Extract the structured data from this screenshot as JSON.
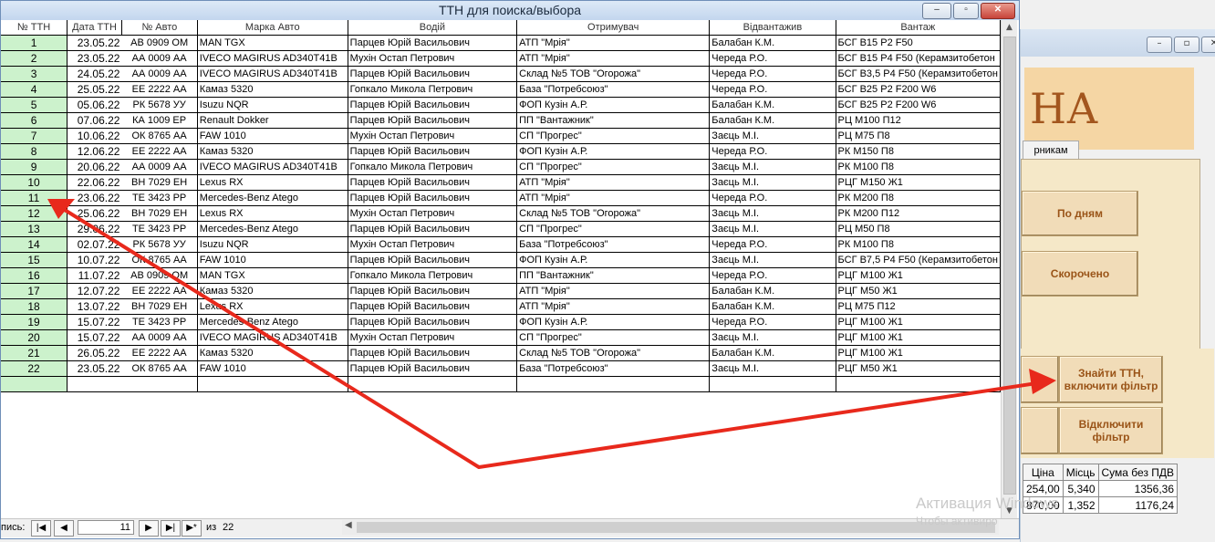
{
  "main_window": {
    "title": "ТТН для поиска/выбора",
    "controls": {
      "minimize": "–",
      "maximize": "▫",
      "close": "✕"
    }
  },
  "grid": {
    "columns": [
      "№ ТТН",
      "Дата ТТН",
      "№ Авто",
      "Марка Авто",
      "Водій",
      "Отримувач",
      "Відвантажив",
      "Вантаж"
    ],
    "rows": [
      [
        "1",
        "23.05.22",
        "АВ 0909 ОМ",
        "MAN TGX",
        "Парцев Юрій Васильович",
        "АТП \"Мрія\"",
        "Балабан К.М.",
        "БСГ В15 Р2 F50"
      ],
      [
        "2",
        "23.05.22",
        "АА 0009 АА",
        "IVECO MAGIRUS AD340T41B",
        "Мухін Остап Петрович",
        "АТП \"Мрія\"",
        "Череда Р.О.",
        "БСГ В15 Р4 F50 (Керамзитобетон"
      ],
      [
        "3",
        "24.05.22",
        "АА 0009 АА",
        "IVECO MAGIRUS AD340T41B",
        "Парцев Юрій Васильович",
        "Склад №5 ТОВ \"Огорожа\"",
        "Череда Р.О.",
        "БСГ В3,5 Р4 F50 (Керамзитобетон"
      ],
      [
        "4",
        "25.05.22",
        "ЕЕ 2222 АА",
        "Камаз 5320",
        "Гопкало Микола Петрович",
        "База \"Потребсоюз\"",
        "Череда Р.О.",
        "БСГ В25 Р2 F200 W6"
      ],
      [
        "5",
        "05.06.22",
        "РК 5678 УУ",
        "Isuzu NQR",
        "Парцев Юрій Васильович",
        "ФОП Кузін А.Р.",
        "Балабан К.М.",
        "БСГ В25 Р2 F200 W6"
      ],
      [
        "6",
        "07.06.22",
        "КА 1009 ЕР",
        "Renault Dokker",
        "Парцев Юрій Васильович",
        "ПП \"Вантажник\"",
        "Балабан К.М.",
        "РЦ М100 П12"
      ],
      [
        "7",
        "10.06.22",
        "ОК 8765 АА",
        "FAW 1010",
        "Мухін Остап Петрович",
        "СП \"Прогрес\"",
        "Заєць М.І.",
        "РЦ М75 П8"
      ],
      [
        "8",
        "12.06.22",
        "ЕЕ 2222 АА",
        "Камаз 5320",
        "Парцев Юрій Васильович",
        "ФОП Кузін А.Р.",
        "Череда Р.О.",
        "РК М150 П8"
      ],
      [
        "9",
        "20.06.22",
        "АА 0009 АА",
        "IVECO MAGIRUS AD340T41B",
        "Гопкало Микола Петрович",
        "СП \"Прогрес\"",
        "Заєць М.І.",
        "РК М100 П8"
      ],
      [
        "10",
        "22.06.22",
        "ВН 7029 ЕН",
        "Lexus RX",
        "Парцев Юрій Васильович",
        "АТП \"Мрія\"",
        "Заєць М.І.",
        "РЦГ М150 Ж1"
      ],
      [
        "11",
        "23.06.22",
        "ТЕ 3423 РР",
        "Mercedes-Benz Atego",
        "Парцев Юрій Васильович",
        "АТП \"Мрія\"",
        "Череда Р.О.",
        "РК М200 П8"
      ],
      [
        "12",
        "25.06.22",
        "ВН 7029 ЕН",
        "Lexus RX",
        "Мухін Остап Петрович",
        "Склад №5 ТОВ \"Огорожа\"",
        "Заєць М.І.",
        "РК М200 П12"
      ],
      [
        "13",
        "29.06.22",
        "ТЕ 3423 РР",
        "Mercedes-Benz Atego",
        "Парцев Юрій Васильович",
        "СП \"Прогрес\"",
        "Заєць М.І.",
        "РЦ М50 П8"
      ],
      [
        "14",
        "02.07.22",
        "РК 5678 УУ",
        "Isuzu NQR",
        "Мухін Остап Петрович",
        "База \"Потребсоюз\"",
        "Череда Р.О.",
        "РК М100 П8"
      ],
      [
        "15",
        "10.07.22",
        "ОК 8765 АА",
        "FAW 1010",
        "Парцев Юрій Васильович",
        "ФОП Кузін А.Р.",
        "Заєць М.І.",
        "БСГ В7,5 Р4 F50 (Керамзитобетон"
      ],
      [
        "16",
        "11.07.22",
        "АВ 0909 ОМ",
        "MAN TGX",
        "Гопкало Микола Петрович",
        "ПП \"Вантажник\"",
        "Череда Р.О.",
        "РЦГ М100 Ж1"
      ],
      [
        "17",
        "12.07.22",
        "ЕЕ 2222 АА",
        "Камаз 5320",
        "Парцев Юрій Васильович",
        "АТП \"Мрія\"",
        "Балабан К.М.",
        "РЦГ М50 Ж1"
      ],
      [
        "18",
        "13.07.22",
        "ВН 7029 ЕН",
        "Lexus RX",
        "Парцев Юрій Васильович",
        "АТП \"Мрія\"",
        "Балабан К.М.",
        "РЦ М75 П12"
      ],
      [
        "19",
        "15.07.22",
        "ТЕ 3423 РР",
        "Mercedes-Benz Atego",
        "Парцев Юрій Васильович",
        "ФОП Кузін А.Р.",
        "Череда Р.О.",
        "РЦГ М100 Ж1"
      ],
      [
        "20",
        "15.07.22",
        "АА 0009 АА",
        "IVECO MAGIRUS AD340T41B",
        "Мухін Остап Петрович",
        "СП \"Прогрес\"",
        "Заєць М.І.",
        "РЦГ М100 Ж1"
      ],
      [
        "21",
        "26.05.22",
        "ЕЕ 2222 АА",
        "Камаз 5320",
        "Парцев Юрій Васильович",
        "Склад №5 ТОВ \"Огорожа\"",
        "Балабан К.М.",
        "РЦГ М100 Ж1"
      ],
      [
        "22",
        "23.05.22",
        "ОК 8765 АА",
        "FAW 1010",
        "Парцев Юрій Васильович",
        "База \"Потребсоюз\"",
        "Заєць М.І.",
        "РЦГ М50 Ж1"
      ]
    ]
  },
  "record_nav": {
    "label": "пись:",
    "current": "11",
    "of_label": "из",
    "total": "22",
    "first_icon": "first-record-icon",
    "prev_icon": "prev-record-icon",
    "next_icon": "next-record-icon",
    "last_icon": "last-record-icon",
    "new_icon": "new-record-icon"
  },
  "background_window": {
    "title_fragment": "НА",
    "tab_label": "рникам",
    "buttons": {
      "by_days": "По дням",
      "short": "Скорочено",
      "find_ttn": "Знайти ТТН, включити фільтр",
      "disable_filter": "Відключити фільтр"
    },
    "table": {
      "headers": [
        "Ціна",
        "Місць",
        "Сума без ПДВ"
      ],
      "rows": [
        [
          "254,00",
          "5,340",
          "1356,36"
        ],
        [
          "870,00",
          "1,352",
          "1176,24"
        ]
      ]
    }
  },
  "watermark": {
    "line1": "Активация Windows",
    "line2": "Чтобы активиро"
  },
  "colors": {
    "row_number_bg": "#ccf2cc",
    "annotation_arrow": "#e8291c",
    "accent_button_text": "#9a5418"
  }
}
